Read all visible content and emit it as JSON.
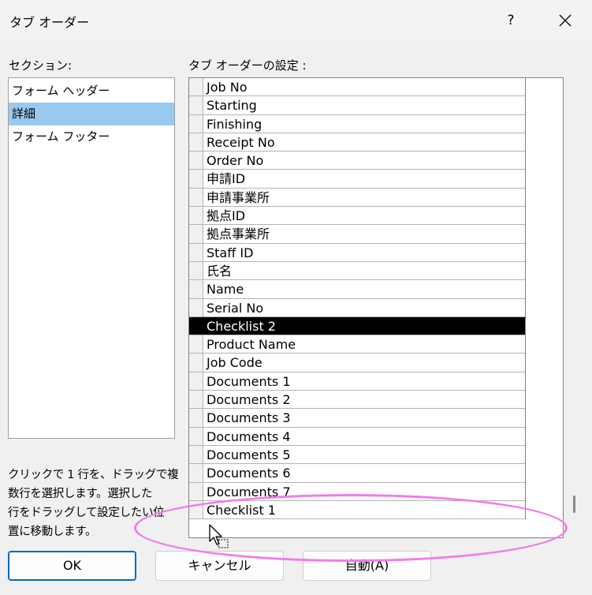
{
  "window": {
    "title": "タブ オーダー",
    "help_label": "?"
  },
  "sections": {
    "label": "セクション:",
    "items": [
      {
        "label": "フォーム ヘッダー",
        "selected": false
      },
      {
        "label": "詳細",
        "selected": true
      },
      {
        "label": "フォーム フッター",
        "selected": false
      }
    ]
  },
  "tab_order": {
    "label": "タブ オーダーの設定 :",
    "rows": [
      {
        "label": "Job No",
        "selected": false
      },
      {
        "label": "Starting",
        "selected": false
      },
      {
        "label": "Finishing",
        "selected": false
      },
      {
        "label": "Receipt No",
        "selected": false
      },
      {
        "label": "Order No",
        "selected": false
      },
      {
        "label": "申請ID",
        "selected": false
      },
      {
        "label": "申請事業所",
        "selected": false
      },
      {
        "label": "拠点ID",
        "selected": false
      },
      {
        "label": "拠点事業所",
        "selected": false
      },
      {
        "label": "Staff ID",
        "selected": false
      },
      {
        "label": "氏名",
        "selected": false
      },
      {
        "label": "Name",
        "selected": false
      },
      {
        "label": "Serial No",
        "selected": false
      },
      {
        "label": "Checklist 2",
        "selected": true
      },
      {
        "label": "Product Name",
        "selected": false
      },
      {
        "label": "Job Code",
        "selected": false
      },
      {
        "label": "Documents 1",
        "selected": false
      },
      {
        "label": "Documents 2",
        "selected": false
      },
      {
        "label": "Documents 3",
        "selected": false
      },
      {
        "label": "Documents 4",
        "selected": false
      },
      {
        "label": "Documents 5",
        "selected": false
      },
      {
        "label": "Documents 6",
        "selected": false
      },
      {
        "label": "Documents 7",
        "selected": false
      },
      {
        "label": "Checklist 1",
        "selected": false
      }
    ]
  },
  "hint": {
    "lines": [
      "クリックで 1 行を、ドラッグで複",
      "数行を選択します。選択した",
      "行をドラッグして設定したい位",
      "置に移動します。"
    ]
  },
  "buttons": {
    "ok": "OK",
    "cancel": "キャンセル",
    "auto": "自動(A)"
  },
  "annotation": {
    "color": "#f27ce9"
  }
}
